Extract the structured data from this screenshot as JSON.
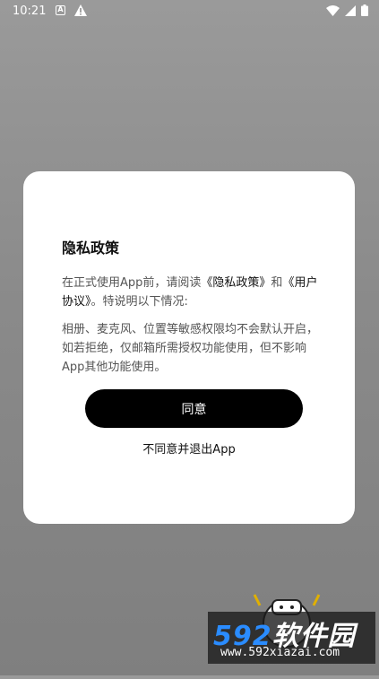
{
  "status": {
    "time": "10:21"
  },
  "dialog": {
    "title": "隐私政策",
    "intro_prefix": "在正式使用App前，请阅读",
    "privacy_link": "《隐私政策》",
    "intro_and": "和",
    "agreement_link": "《用户协议》",
    "intro_suffix": "。特说明以下情况:",
    "body": "相册、麦克风、位置等敏感权限均不会默认开启，如若拒绝，仅邮箱所需授权功能使用，但不影响App其他功能使用。",
    "agree_label": "同意",
    "disagree_label": "不同意并退出App"
  },
  "watermark": {
    "digits": "592",
    "title": "软件园",
    "url": "www.592xiazai.com"
  }
}
